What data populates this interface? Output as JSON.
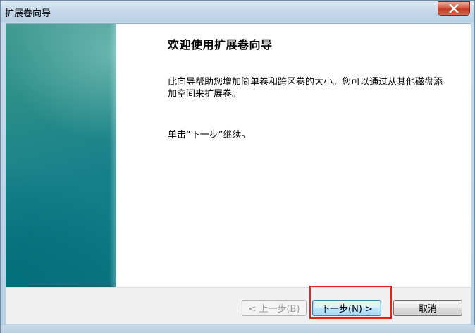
{
  "window": {
    "title": "扩展卷向导"
  },
  "content": {
    "heading": "欢迎使用扩展卷向导",
    "description": "此向导帮助您增加简单卷和跨区卷的大小。您可以通过从其他磁盘添加空间来扩展卷。",
    "instruction": "单击“下一步”继续。"
  },
  "buttons": {
    "back_label": "< 上一步(B)",
    "next_label": "下一步(N) >",
    "cancel_label": "取消"
  },
  "icons": {
    "close": "close-icon"
  },
  "colors": {
    "highlight": "#e0241e",
    "side_panel": "#16808a",
    "close_button": "#c23a22"
  }
}
